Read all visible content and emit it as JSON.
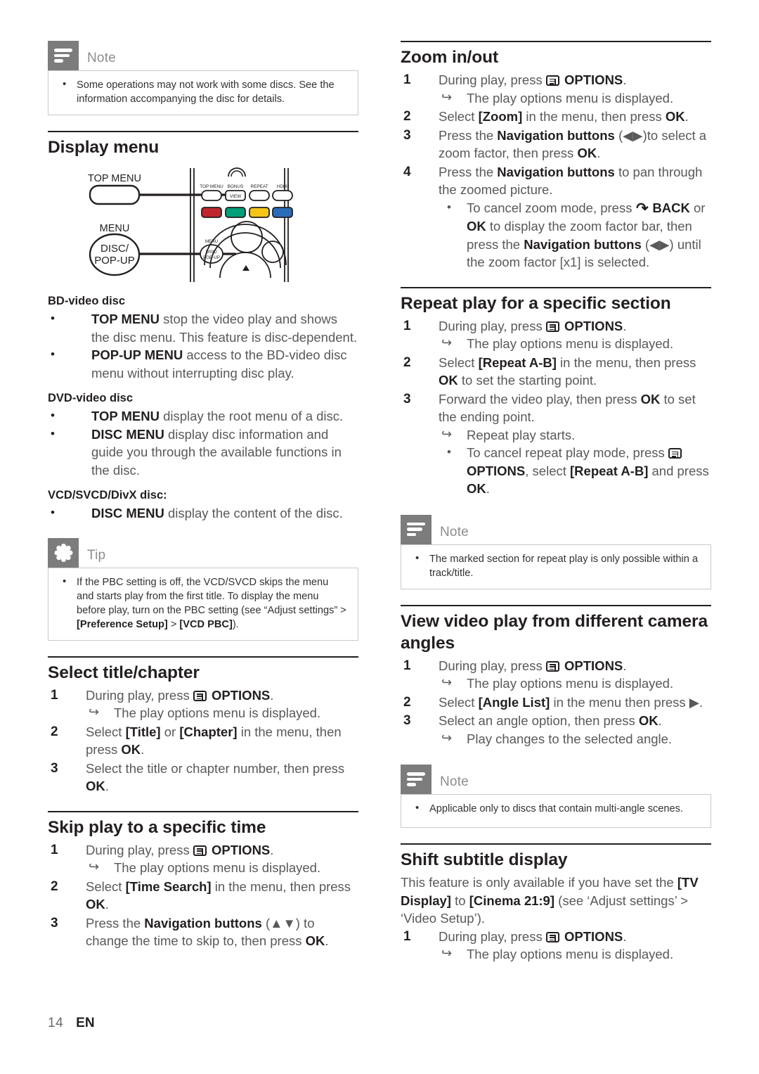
{
  "page": {
    "number": "14",
    "language": "EN"
  },
  "icons": {
    "note": "note-icon",
    "tip": "tip-icon",
    "options": "options-button-icon",
    "back": "back-arrow-icon"
  },
  "left_column": {
    "note_top": {
      "title": "Note",
      "items": [
        "Some operations may not work with some discs. See the information accompanying the disc for details."
      ]
    },
    "display_menu": {
      "heading": "Display menu",
      "figure": {
        "name": "remote-control-diagram",
        "labels": [
          "TOP MENU",
          "MENU",
          "DISC/",
          "POP-UP"
        ],
        "remote_keys": [
          "TOP MENU",
          "BONUS VIEW",
          "REPEAT",
          "HDMI",
          "MENU DISC/POP-UP"
        ],
        "color_keys": [
          "#c0272d",
          "#00a079",
          "#f5c518",
          "#2b6cb8"
        ]
      },
      "groups": [
        {
          "title": "BD-video disc",
          "items": [
            {
              "bold": "TOP MENU",
              "text": " stop the video play and shows the disc menu. This feature is disc-dependent."
            },
            {
              "bold": "POP-UP MENU",
              "text": " access to the BD-video disc menu without interrupting disc play."
            }
          ]
        },
        {
          "title": "DVD-video disc",
          "items": [
            {
              "bold": "TOP MENU",
              "text": " display the root menu of a disc."
            },
            {
              "bold": "DISC MENU",
              "text": " display disc information and guide you through the available functions in the disc."
            }
          ]
        },
        {
          "title": "VCD/SVCD/DivX disc:",
          "items": [
            {
              "bold": "DISC MENU",
              "text": " display the content of the disc."
            }
          ]
        }
      ]
    },
    "tip": {
      "title": "Tip",
      "items": [
        "If the PBC setting is off, the VCD/SVCD skips the menu and starts play from the first title. To display the menu before play, turn on the PBC setting (see “Adjust settings” > [Preference Setup] > [VCD PBC])."
      ],
      "bold_terms": [
        "[Preference Setup]",
        "[VCD PBC]"
      ]
    },
    "select_title_chapter": {
      "heading": "Select title/chapter",
      "steps": [
        {
          "num": "1",
          "parts": [
            {
              "t": "During play, press "
            },
            {
              "icon": "options"
            },
            {
              "t": " ",
              "b": false
            },
            {
              "t": "OPTIONS",
              "b": true
            },
            {
              "t": "."
            }
          ],
          "sub": [
            {
              "type": "arrow",
              "text": "The play options menu is displayed."
            }
          ]
        },
        {
          "num": "2",
          "parts": [
            {
              "t": "Select "
            },
            {
              "t": "[Title]",
              "b": true
            },
            {
              "t": " or "
            },
            {
              "t": "[Chapter]",
              "b": true
            },
            {
              "t": " in the menu, then press "
            },
            {
              "t": "OK",
              "b": true
            },
            {
              "t": "."
            }
          ],
          "sub": []
        },
        {
          "num": "3",
          "parts": [
            {
              "t": "Select the title or chapter number, then press "
            },
            {
              "t": "OK",
              "b": true
            },
            {
              "t": "."
            }
          ],
          "sub": []
        }
      ]
    },
    "skip_play": {
      "heading": "Skip play to a specific time",
      "steps": [
        {
          "num": "1",
          "parts": [
            {
              "t": "During play, press "
            },
            {
              "icon": "options"
            },
            {
              "t": " "
            },
            {
              "t": "OPTIONS",
              "b": true
            },
            {
              "t": "."
            }
          ],
          "sub": [
            {
              "type": "arrow",
              "text": "The play options menu is displayed."
            }
          ]
        },
        {
          "num": "2",
          "parts": [
            {
              "t": "Select "
            },
            {
              "t": "[Time Search]",
              "b": true
            },
            {
              "t": " in the menu, then press "
            },
            {
              "t": "OK",
              "b": true
            },
            {
              "t": "."
            }
          ],
          "sub": []
        },
        {
          "num": "3",
          "parts": [
            {
              "t": "Press the "
            },
            {
              "t": "Navigation buttons",
              "b": true
            },
            {
              "t": " (▲▼) to change the time to skip to, then press "
            },
            {
              "t": "OK",
              "b": true
            },
            {
              "t": "."
            }
          ],
          "sub": []
        }
      ]
    }
  },
  "right_column": {
    "zoom": {
      "heading": "Zoom in/out",
      "steps": [
        {
          "num": "1",
          "parts": [
            {
              "t": "During play, press "
            },
            {
              "icon": "options"
            },
            {
              "t": " "
            },
            {
              "t": "OPTIONS",
              "b": true
            },
            {
              "t": "."
            }
          ],
          "sub": [
            {
              "type": "arrow",
              "text": "The play options menu is displayed."
            }
          ]
        },
        {
          "num": "2",
          "parts": [
            {
              "t": "Select "
            },
            {
              "t": "[Zoom]",
              "b": true
            },
            {
              "t": " in the menu, then press "
            },
            {
              "t": "OK",
              "b": true
            },
            {
              "t": "."
            }
          ],
          "sub": []
        },
        {
          "num": "3",
          "parts": [
            {
              "t": "Press the "
            },
            {
              "t": "Navigation buttons",
              "b": true
            },
            {
              "t": " (◀▶)to select a zoom factor, then press "
            },
            {
              "t": "OK",
              "b": true
            },
            {
              "t": "."
            }
          ],
          "sub": []
        },
        {
          "num": "4",
          "parts": [
            {
              "t": "Press the "
            },
            {
              "t": "Navigation buttons",
              "b": true
            },
            {
              "t": " to pan through the zoomed picture."
            }
          ],
          "sub": [
            {
              "type": "dot",
              "parts": [
                {
                  "t": "To cancel zoom mode, press "
                },
                {
                  "icon": "back"
                },
                {
                  "t": " "
                },
                {
                  "t": "BACK",
                  "b": true
                },
                {
                  "t": " or "
                },
                {
                  "t": "OK",
                  "b": true
                },
                {
                  "t": " to display the zoom factor bar, then press the "
                },
                {
                  "t": "Navigation buttons",
                  "b": true
                },
                {
                  "t": " (◀▶) until the zoom factor [x1] is selected."
                }
              ]
            }
          ]
        }
      ]
    },
    "repeat_section": {
      "heading": "Repeat play for a specific section",
      "steps": [
        {
          "num": "1",
          "parts": [
            {
              "t": "During play, press "
            },
            {
              "icon": "options"
            },
            {
              "t": " "
            },
            {
              "t": "OPTIONS",
              "b": true
            },
            {
              "t": "."
            }
          ],
          "sub": [
            {
              "type": "arrow",
              "text": "The play options menu is displayed."
            }
          ]
        },
        {
          "num": "2",
          "parts": [
            {
              "t": "Select "
            },
            {
              "t": "[Repeat A-B]",
              "b": true
            },
            {
              "t": " in the menu, then press "
            },
            {
              "t": "OK",
              "b": true
            },
            {
              "t": " to set the starting point."
            }
          ],
          "sub": []
        },
        {
          "num": "3",
          "parts": [
            {
              "t": "Forward the video play, then press "
            },
            {
              "t": "OK",
              "b": true
            },
            {
              "t": " to set the ending point."
            }
          ],
          "sub": [
            {
              "type": "arrow",
              "text": "Repeat play starts."
            },
            {
              "type": "dot",
              "parts": [
                {
                  "t": "To cancel repeat play mode, press "
                },
                {
                  "icon": "options"
                },
                {
                  "t": " "
                },
                {
                  "t": "OPTIONS",
                  "b": true
                },
                {
                  "t": ", select "
                },
                {
                  "t": "[Repeat A-B]",
                  "b": true
                },
                {
                  "t": " and press "
                },
                {
                  "t": "OK",
                  "b": true
                },
                {
                  "t": "."
                }
              ]
            }
          ]
        }
      ]
    },
    "note_repeat": {
      "title": "Note",
      "items": [
        "The marked section for repeat play is only possible within a track/title."
      ]
    },
    "camera_angles": {
      "heading": "View video play from different camera angles",
      "steps": [
        {
          "num": "1",
          "parts": [
            {
              "t": "During play, press "
            },
            {
              "icon": "options"
            },
            {
              "t": " "
            },
            {
              "t": "OPTIONS",
              "b": true
            },
            {
              "t": "."
            }
          ],
          "sub": [
            {
              "type": "arrow",
              "text": "The play options menu is displayed."
            }
          ]
        },
        {
          "num": "2",
          "parts": [
            {
              "t": "Select "
            },
            {
              "t": "[Angle List]",
              "b": true
            },
            {
              "t": " in the menu then press ▶."
            }
          ],
          "sub": []
        },
        {
          "num": "3",
          "parts": [
            {
              "t": "Select an angle option, then press "
            },
            {
              "t": "OK",
              "b": true
            },
            {
              "t": "."
            }
          ],
          "sub": [
            {
              "type": "arrow",
              "text": "Play changes to the selected angle."
            }
          ]
        }
      ]
    },
    "note_angles": {
      "title": "Note",
      "items": [
        "Applicable only to discs that contain multi-angle scenes."
      ]
    },
    "shift_subtitle": {
      "heading": "Shift subtitle display",
      "intro_parts": [
        {
          "t": "This feature is only available if you have set the "
        },
        {
          "t": "[TV Display]",
          "b": true
        },
        {
          "t": " to "
        },
        {
          "t": "[Cinema 21:9]",
          "b": true
        },
        {
          "t": " (see ‘Adjust settings’ > ‘Video Setup’)."
        }
      ],
      "steps": [
        {
          "num": "1",
          "parts": [
            {
              "t": "During play, press "
            },
            {
              "icon": "options"
            },
            {
              "t": " "
            },
            {
              "t": "OPTIONS",
              "b": true
            },
            {
              "t": "."
            }
          ],
          "sub": [
            {
              "type": "arrow",
              "text": "The play options menu is displayed."
            }
          ]
        }
      ]
    }
  }
}
